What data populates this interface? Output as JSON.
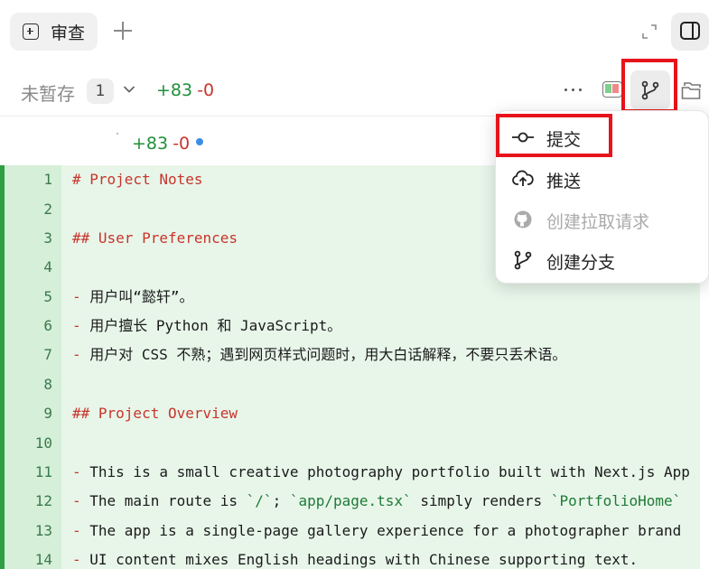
{
  "tab": {
    "label": "审查"
  },
  "toolbar": {
    "unstaged_label": "未暂存",
    "unstaged_count": "1",
    "additions": "+83",
    "deletions": "-0"
  },
  "file_header": {
    "additions": "+83",
    "deletions": "-0"
  },
  "menu": {
    "items": [
      {
        "label": "提交",
        "icon": "commit-icon",
        "enabled": true
      },
      {
        "label": "推送",
        "icon": "push-icon",
        "enabled": true
      },
      {
        "label": "创建拉取请求",
        "icon": "github-icon",
        "enabled": false
      },
      {
        "label": "创建分支",
        "icon": "branch-icon",
        "enabled": true
      }
    ]
  },
  "code": {
    "lines": [
      {
        "n": "1",
        "text": "# Project Notes"
      },
      {
        "n": "2",
        "text": ""
      },
      {
        "n": "3",
        "text": "## User Preferences"
      },
      {
        "n": "4",
        "text": ""
      },
      {
        "n": "5",
        "text": "- 用户叫“懿轩”。"
      },
      {
        "n": "6",
        "text": "- 用户擅长 Python 和 JavaScript。"
      },
      {
        "n": "7",
        "text": "- 用户对 CSS 不熟；遇到网页样式问题时，用大白话解释，不要只丢术语。"
      },
      {
        "n": "8",
        "text": ""
      },
      {
        "n": "9",
        "text": "## Project Overview"
      },
      {
        "n": "10",
        "text": ""
      },
      {
        "n": "11",
        "text": "- This is a small creative photography portfolio built with Next.js App"
      },
      {
        "n": "12",
        "text": "- The main route is `/`; `app/page.tsx` simply renders `PortfolioHome`"
      },
      {
        "n": "13",
        "text": "- The app is a single-page gallery experience for a photographer brand"
      },
      {
        "n": "14",
        "text": "- UI content mixes English headings with Chinese supporting text."
      }
    ]
  },
  "colors": {
    "addition": "#1f8f3a",
    "deletion": "#c8352b",
    "added_line_bg": "#e8f6ea",
    "highlight": "#e8141c"
  }
}
